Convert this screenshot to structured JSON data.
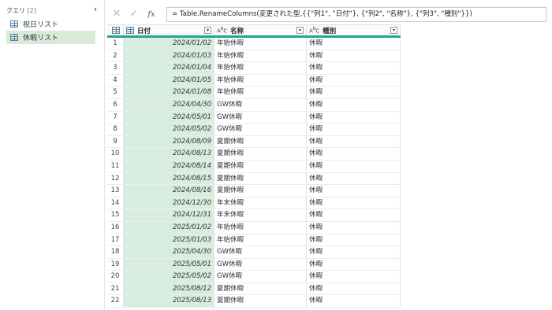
{
  "query_pane": {
    "title": "クエリ",
    "count": "[2]",
    "collapse_glyph": "‹",
    "items": [
      {
        "label": "祝日リスト",
        "selected": false
      },
      {
        "label": "休暇リスト",
        "selected": true
      }
    ]
  },
  "formula_bar": {
    "cancel_glyph": "✕",
    "commit_glyph": "✓",
    "fx_label": "fx",
    "formula": "= Table.RenameColumns(変更された型,{{\"列1\", \"日付\"}, {\"列2\", \"名称\"}, {\"列3\", \"種別\"}})"
  },
  "grid": {
    "columns": [
      {
        "name": "日付",
        "type_icon": "calendar-table-icon"
      },
      {
        "name": "名称",
        "type_icon": "abc-text-icon"
      },
      {
        "name": "種別",
        "type_icon": "abc-text-icon"
      }
    ],
    "rows": [
      {
        "n": "1",
        "date": "2024/01/02",
        "name": "年始休暇",
        "kind": "休暇"
      },
      {
        "n": "2",
        "date": "2024/01/03",
        "name": "年始休暇",
        "kind": "休暇"
      },
      {
        "n": "3",
        "date": "2024/01/04",
        "name": "年始休暇",
        "kind": "休暇"
      },
      {
        "n": "4",
        "date": "2024/01/05",
        "name": "年始休暇",
        "kind": "休暇"
      },
      {
        "n": "5",
        "date": "2024/01/08",
        "name": "年始休暇",
        "kind": "休暇"
      },
      {
        "n": "6",
        "date": "2024/04/30",
        "name": "GW休暇",
        "kind": "休暇"
      },
      {
        "n": "7",
        "date": "2024/05/01",
        "name": "GW休暇",
        "kind": "休暇"
      },
      {
        "n": "8",
        "date": "2024/05/02",
        "name": "GW休暇",
        "kind": "休暇"
      },
      {
        "n": "9",
        "date": "2024/08/09",
        "name": "夏期休暇",
        "kind": "休暇"
      },
      {
        "n": "10",
        "date": "2024/08/13",
        "name": "夏期休暇",
        "kind": "休暇"
      },
      {
        "n": "11",
        "date": "2024/08/14",
        "name": "夏期休暇",
        "kind": "休暇"
      },
      {
        "n": "12",
        "date": "2024/08/15",
        "name": "夏期休暇",
        "kind": "休暇"
      },
      {
        "n": "13",
        "date": "2024/08/16",
        "name": "夏期休暇",
        "kind": "休暇"
      },
      {
        "n": "14",
        "date": "2024/12/30",
        "name": "年末休暇",
        "kind": "休暇"
      },
      {
        "n": "15",
        "date": "2024/12/31",
        "name": "年末休暇",
        "kind": "休暇"
      },
      {
        "n": "16",
        "date": "2025/01/02",
        "name": "年始休暇",
        "kind": "休暇"
      },
      {
        "n": "17",
        "date": "2025/01/03",
        "name": "年始休暇",
        "kind": "休暇"
      },
      {
        "n": "18",
        "date": "2025/04/30",
        "name": "GW休暇",
        "kind": "休暇"
      },
      {
        "n": "19",
        "date": "2025/05/01",
        "name": "GW休暇",
        "kind": "休暇"
      },
      {
        "n": "20",
        "date": "2025/05/02",
        "name": "GW休暇",
        "kind": "休暇"
      },
      {
        "n": "21",
        "date": "2025/08/12",
        "name": "夏期休暇",
        "kind": "休暇"
      },
      {
        "n": "22",
        "date": "2025/08/13",
        "name": "夏期休暇",
        "kind": "休暇"
      }
    ]
  }
}
